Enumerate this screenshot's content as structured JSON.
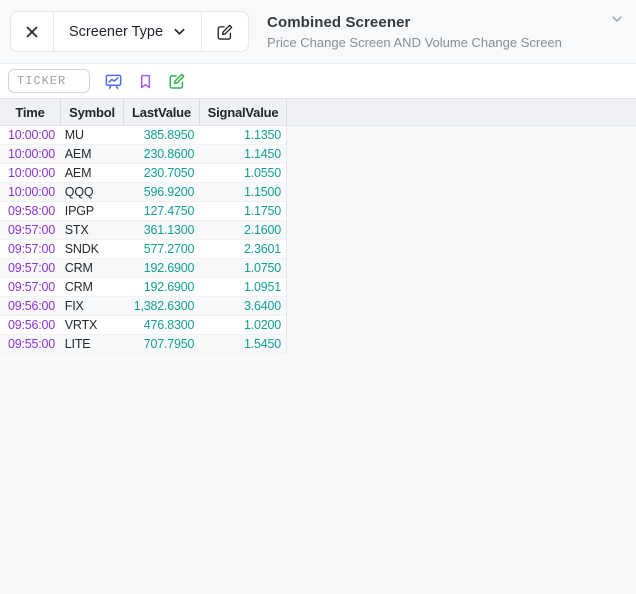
{
  "topbar": {
    "screener_type_label": "Screener Type",
    "title": "Combined Screener",
    "subtitle": "Price Change Screen AND Volume Change Screen"
  },
  "toolbar": {
    "ticker_placeholder": "TICKER"
  },
  "icons": {
    "close": "close-icon",
    "chevron_down": "chevron-down-icon",
    "edit_screener": "edit-pencil-square-icon",
    "chart_board": "chart-presentation-icon",
    "bookmark": "bookmark-icon",
    "annotate": "edit-note-icon",
    "collapse": "chevron-down-icon"
  },
  "colors": {
    "time_text": "#8C32D6",
    "value_text": "#12A093",
    "icon_chart": "#4C6EF5",
    "icon_bookmark": "#A855F7",
    "icon_annotate": "#2FB344",
    "header_bg": "#EFF1F4",
    "topbar_bg": "#F8F9FA"
  },
  "table": {
    "columns": [
      "Time",
      "Symbol",
      "LastValue",
      "SignalValue"
    ],
    "rows": [
      {
        "time": "10:00:00",
        "symbol": "MU",
        "last_value": "385.8950",
        "signal_value": "1.1350"
      },
      {
        "time": "10:00:00",
        "symbol": "AEM",
        "last_value": "230.8600",
        "signal_value": "1.1450"
      },
      {
        "time": "10:00:00",
        "symbol": "AEM",
        "last_value": "230.7050",
        "signal_value": "1.0550"
      },
      {
        "time": "10:00:00",
        "symbol": "QQQ",
        "last_value": "596.9200",
        "signal_value": "1.1500"
      },
      {
        "time": "09:58:00",
        "symbol": "IPGP",
        "last_value": "127.4750",
        "signal_value": "1.1750"
      },
      {
        "time": "09:57:00",
        "symbol": "STX",
        "last_value": "361.1300",
        "signal_value": "2.1600"
      },
      {
        "time": "09:57:00",
        "symbol": "SNDK",
        "last_value": "577.2700",
        "signal_value": "2.3601"
      },
      {
        "time": "09:57:00",
        "symbol": "CRM",
        "last_value": "192.6900",
        "signal_value": "1.0750"
      },
      {
        "time": "09:57:00",
        "symbol": "CRM",
        "last_value": "192.6900",
        "signal_value": "1.0951"
      },
      {
        "time": "09:56:00",
        "symbol": "FIX",
        "last_value": "1,382.6300",
        "signal_value": "3.6400"
      },
      {
        "time": "09:56:00",
        "symbol": "VRTX",
        "last_value": "476.8300",
        "signal_value": "1.0200"
      },
      {
        "time": "09:55:00",
        "symbol": "LITE",
        "last_value": "707.7950",
        "signal_value": "1.5450"
      }
    ]
  }
}
